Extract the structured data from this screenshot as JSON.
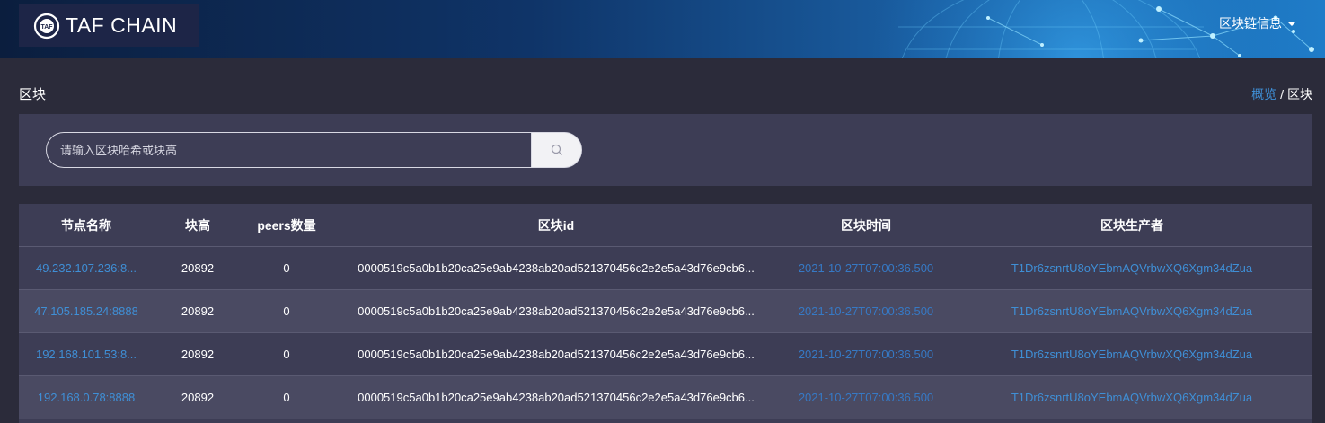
{
  "header": {
    "logo_text": "TAF CHAIN",
    "logo_badge": "TAF",
    "menu_label": "区块链信息"
  },
  "page": {
    "title": "区块"
  },
  "breadcrumb": {
    "home": "概览",
    "separator": "/",
    "current": "区块"
  },
  "search": {
    "placeholder": "请输入区块哈希或块高"
  },
  "table": {
    "columns": [
      "节点名称",
      "块高",
      "peers数量",
      "区块id",
      "区块时间",
      "区块生产者"
    ],
    "rows": [
      {
        "node": "49.232.107.236:8...",
        "height": "20892",
        "peers": "0",
        "block_id": "0000519c5a0b1b20ca25e9ab4238ab20ad521370456c2e2e5a43d76e9cb6...",
        "time": "2021-10-27T07:00:36.500",
        "producer": "T1Dr6zsnrtU8oYEbmAQVrbwXQ6Xgm34dZua"
      },
      {
        "node": "47.105.185.24:8888",
        "height": "20892",
        "peers": "0",
        "block_id": "0000519c5a0b1b20ca25e9ab4238ab20ad521370456c2e2e5a43d76e9cb6...",
        "time": "2021-10-27T07:00:36.500",
        "producer": "T1Dr6zsnrtU8oYEbmAQVrbwXQ6Xgm34dZua"
      },
      {
        "node": "192.168.101.53:8...",
        "height": "20892",
        "peers": "0",
        "block_id": "0000519c5a0b1b20ca25e9ab4238ab20ad521370456c2e2e5a43d76e9cb6...",
        "time": "2021-10-27T07:00:36.500",
        "producer": "T1Dr6zsnrtU8oYEbmAQVrbwXQ6Xgm34dZua"
      },
      {
        "node": "192.168.0.78:8888",
        "height": "20892",
        "peers": "0",
        "block_id": "0000519c5a0b1b20ca25e9ab4238ab20ad521370456c2e2e5a43d76e9cb6...",
        "time": "2021-10-27T07:00:36.500",
        "producer": "T1Dr6zsnrtU8oYEbmAQVrbwXQ6Xgm34dZua"
      }
    ]
  },
  "icons": {
    "search": "search-icon",
    "menu_caret": "chevron-down-icon",
    "logo": "taf-logo-icon",
    "banner": "globe-network-graphic"
  },
  "colors": {
    "background": "#2b2b3a",
    "panel": "#3d3d55",
    "link": "#3f8fd6",
    "header_dark": "#0b1e3e",
    "header_light": "#1f7cc8"
  }
}
